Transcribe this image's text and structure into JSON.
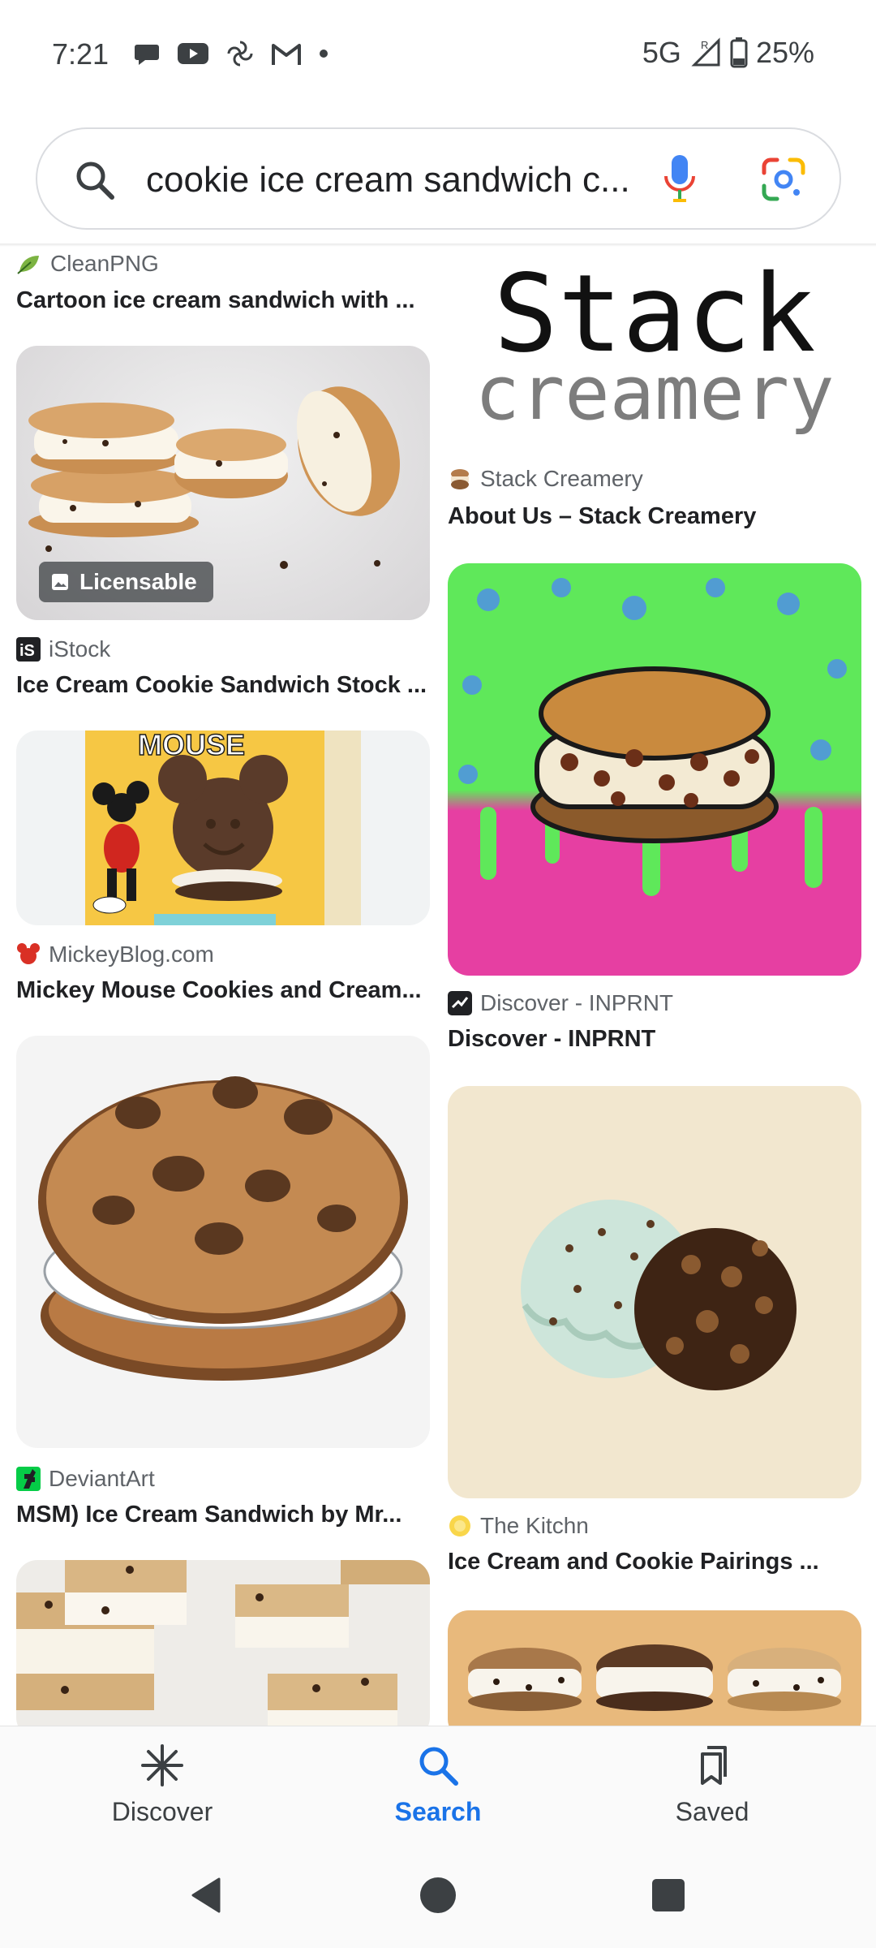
{
  "status_bar": {
    "time": "7:21",
    "notification_icons": [
      "chat-bubble-icon",
      "youtube-icon",
      "pinwheel-icon",
      "gmail-icon",
      "dot-icon"
    ],
    "network": "5G",
    "battery": "25%"
  },
  "search": {
    "query": "cookie ice cream sandwich c..."
  },
  "results": {
    "left": [
      {
        "source": "CleanPNG",
        "title": "Cartoon ice cream sandwich with ..."
      },
      {
        "source": "iStock",
        "title": "Ice Cream Cookie Sandwich Stock ...",
        "badge": "Licensable"
      },
      {
        "source": "MickeyBlog.com",
        "title": "Mickey Mouse Cookies and Cream...",
        "image_text": "MOUSE"
      },
      {
        "source": "DeviantArt",
        "title": "MSM) Ice Cream Sandwich by Mr..."
      },
      {
        "source": "",
        "title": ""
      }
    ],
    "right": [
      {
        "source": "Stack Creamery",
        "title": "About Us – Stack Creamery",
        "logo_line1": "Stack",
        "logo_line2": "creamery"
      },
      {
        "source": "Discover - INPRNT",
        "title": "Discover - INPRNT"
      },
      {
        "source": "The Kitchn",
        "title": "Ice Cream and Cookie Pairings ..."
      },
      {
        "source": "",
        "title": ""
      }
    ]
  },
  "bottom_nav": {
    "items": [
      {
        "label": "Discover",
        "icon": "asterisk-icon"
      },
      {
        "label": "Search",
        "icon": "search-icon",
        "active": true
      },
      {
        "label": "Saved",
        "icon": "bookmarks-icon"
      }
    ]
  },
  "colors": {
    "accent": "#1a73e8",
    "text": "#202124",
    "secondary_text": "#5f6368"
  }
}
